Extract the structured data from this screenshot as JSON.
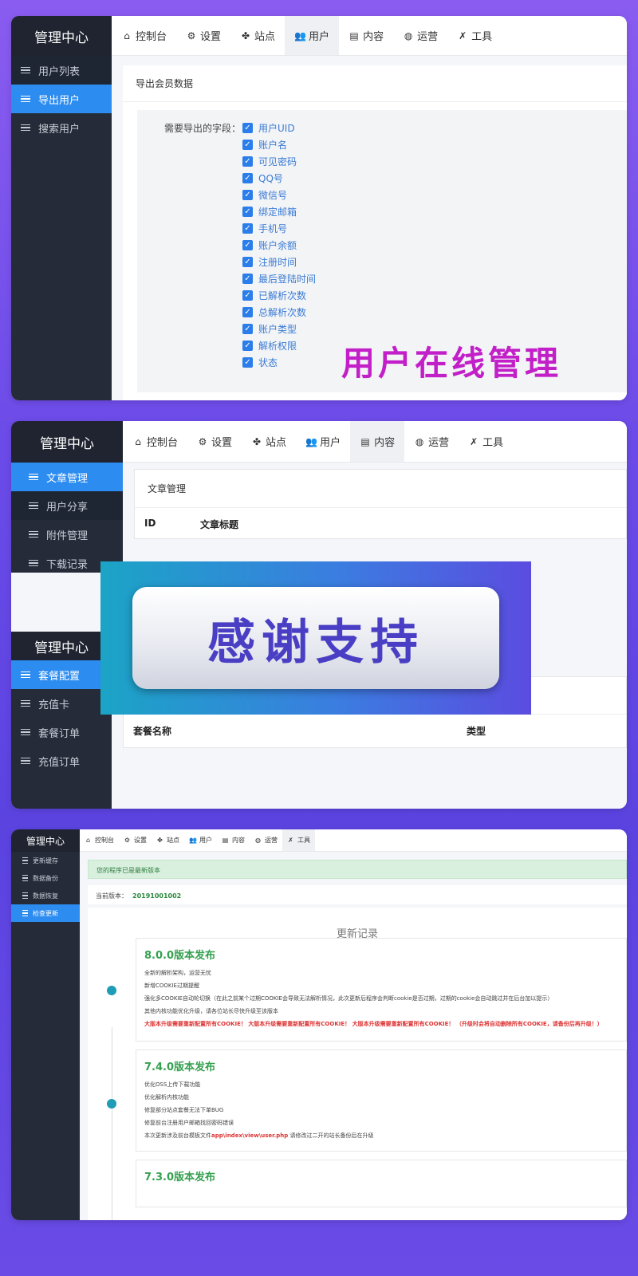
{
  "panel1": {
    "brand": "管理中心",
    "sidebar": [
      "用户列表",
      "导出用户",
      "搜索用户"
    ],
    "nav": [
      {
        "icon": "home-icon",
        "glyph": "⌂",
        "label": "控制台"
      },
      {
        "icon": "gear-icon",
        "glyph": "⚙",
        "label": "设置"
      },
      {
        "icon": "sites-icon",
        "glyph": "✤",
        "label": "站点"
      },
      {
        "icon": "users-icon",
        "glyph": "👥",
        "label": "用户"
      },
      {
        "icon": "document-icon",
        "glyph": "▤",
        "label": "内容"
      },
      {
        "icon": "globe-icon",
        "glyph": "◍",
        "label": "运营"
      },
      {
        "icon": "tools-icon",
        "glyph": "✗",
        "label": "工具"
      }
    ],
    "card_title": "导出会员数据",
    "field_label": "需要导出的字段：",
    "fields": [
      "用户UID",
      "账户名",
      "可见密码",
      "QQ号",
      "微信号",
      "绑定邮箱",
      "手机号",
      "账户余额",
      "注册时间",
      "最后登陆时间",
      "已解析次数",
      "总解析次数",
      "账户类型",
      "解析权限",
      "状态"
    ],
    "overlay": "用户在线管理",
    "colors": {
      "accent": "#2d8cf0",
      "overlay": "#c21fc9",
      "checkbox": "#2b7de9"
    }
  },
  "panel2": {
    "brand": "管理中心",
    "sidebar": [
      "文章管理",
      "用户分享",
      "附件管理",
      "下载记录"
    ],
    "nav": [
      {
        "icon": "home-icon",
        "glyph": "⌂",
        "label": "控制台"
      },
      {
        "icon": "gear-icon",
        "glyph": "⚙",
        "label": "设置"
      },
      {
        "icon": "sites-icon",
        "glyph": "✤",
        "label": "站点"
      },
      {
        "icon": "users-icon",
        "glyph": "👥",
        "label": "用户"
      },
      {
        "icon": "document-icon",
        "glyph": "▤",
        "label": "内容"
      },
      {
        "icon": "globe-icon",
        "glyph": "◍",
        "label": "运营"
      },
      {
        "icon": "tools-icon",
        "glyph": "✗",
        "label": "工具"
      }
    ],
    "article_title": "文章管理",
    "article_cols": [
      "ID",
      "文章标题"
    ],
    "banner": "感谢支持",
    "brand2": "管理中心",
    "sidebar2": [
      "套餐配置",
      "充值卡",
      "套餐订单",
      "充值订单"
    ],
    "pkg_cols": [
      "套餐名称",
      "类型"
    ]
  },
  "panel3": {
    "brand": "管理中心",
    "sidebar": [
      "更新缓存",
      "数据备份",
      "数据恢复",
      "检查更新"
    ],
    "nav": [
      {
        "icon": "home-icon",
        "glyph": "⌂",
        "label": "控制台"
      },
      {
        "icon": "gear-icon",
        "glyph": "⚙",
        "label": "设置"
      },
      {
        "icon": "sites-icon",
        "glyph": "✤",
        "label": "站点"
      },
      {
        "icon": "users-icon",
        "glyph": "👥",
        "label": "用户"
      },
      {
        "icon": "document-icon",
        "glyph": "▤",
        "label": "内容"
      },
      {
        "icon": "globe-icon",
        "glyph": "◍",
        "label": "运营"
      },
      {
        "icon": "tools-icon",
        "glyph": "✗",
        "label": "工具"
      }
    ],
    "notice": "您的程序已是最新版本",
    "version_label": "当前版本：",
    "version_value": "20191001002",
    "log_title": "更新记录",
    "releases": [
      {
        "title": "8.0.0版本发布",
        "lines": [
          "全新的解析架构，运营无忧",
          "新增COOKIE过期提醒",
          "强化多COOKIE自动轮切换（在此之前某个过期COOKIE会导致无法解析情况，此次更新后程序会判断cookie是否过期，过期的cookie会自动跳过并在后台加以提示）",
          "其他内核功能优化升级，请各位站长尽快升级至该版本"
        ],
        "warn": "大版本升级需要重新配置所有COOKIE！ 大版本升级需要重新配置所有COOKIE！ 大版本升级需要重新配置所有COOKIE！ （升级时会将自动删除所有COOKIE，请备份后再升级！）"
      },
      {
        "title": "7.4.0版本发布",
        "lines": [
          "优化OSS上传下载功能",
          "优化解析内核功能",
          "修复部分站点套餐无法下单BUG",
          "修复前台注册用户邮箱找回密码错误"
        ],
        "path_pre": "本次更新涉及前台模板文件",
        "path": "app\\index\\view\\user.php",
        "path_post": " 请修改过二开的站长备份后在升级"
      },
      {
        "title": "7.3.0版本发布"
      }
    ]
  }
}
